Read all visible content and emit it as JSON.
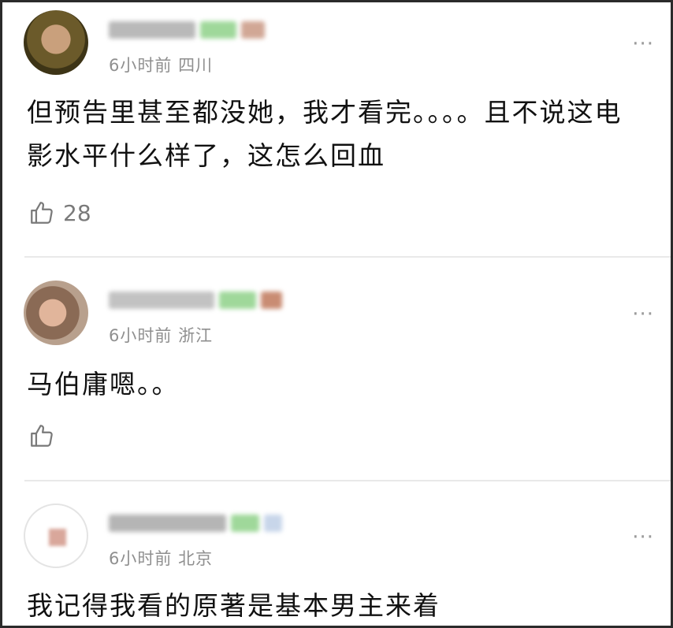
{
  "comments": [
    {
      "time": "6小时前",
      "location": "四川",
      "text": "但预告里甚至都没她，我才看完。。。。且不说这电影水平什么样了，这怎么回血",
      "likes": "28",
      "more": "···"
    },
    {
      "time": "6小时前",
      "location": "浙江",
      "text": "马伯庸嗯。。",
      "likes": "",
      "more": "···"
    },
    {
      "time": "6小时前",
      "location": "北京",
      "text": "我记得我看的原著是基本男主来着",
      "likes": "",
      "more": "···"
    }
  ],
  "icons": {
    "like": "thumbs-up-icon",
    "more": "more-dots-icon"
  },
  "colors": {
    "text": "#111111",
    "meta": "#8f8f8f",
    "divider": "#e9e9e9",
    "frame": "#2b2b2b"
  }
}
